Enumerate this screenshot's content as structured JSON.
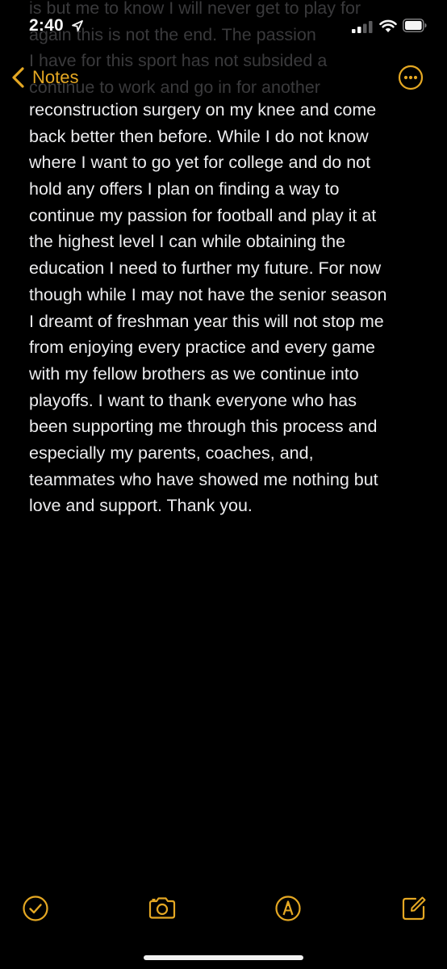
{
  "status_bar": {
    "time": "2:40"
  },
  "nav": {
    "back_label": "Notes"
  },
  "ghost_lines": [
    "is but me to know I will never get to play for",
    "again this is not the end. The passion",
    "I have for this sport has not subsided a",
    "continue to work and go in for another"
  ],
  "note": {
    "lines": [
      "reconstruction surgery on my knee and come",
      "back better then before. While I do not know",
      "where I want to go yet for college and do not",
      "hold any offers I plan on finding a way to",
      "continue my passion for football and play it at",
      "the highest level I can while obtaining the",
      "education I need to further my future. For now",
      "though while I may not have the senior season",
      "I dreamt of freshman year this will not stop me",
      "from enjoying every practice and every game",
      "with my fellow brothers as we continue into",
      "playoffs. I want to thank everyone who has",
      "been supporting me through this process and",
      "especially my parents, coaches, and,",
      "teammates who have showed me nothing but",
      "love and support. Thank you."
    ]
  },
  "colors": {
    "accent": "#e5a823",
    "background": "#000000",
    "text": "#ececee"
  },
  "toolbar": {
    "icons": [
      "checklist-icon",
      "camera-icon",
      "markup-icon",
      "compose-icon"
    ]
  }
}
